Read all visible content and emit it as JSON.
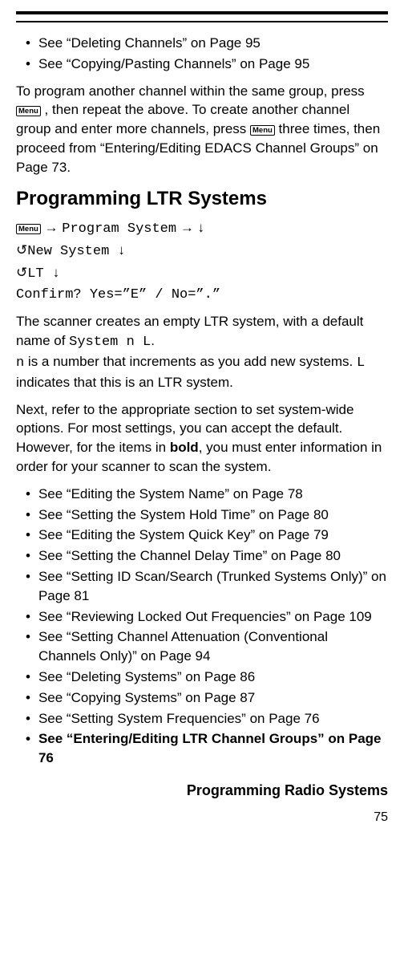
{
  "menu_label": "Menu",
  "top_bullets": [
    "See “Deleting Channels” on Page 95",
    "See “Copying/Pasting Channels” on Page 95"
  ],
  "para1_a": "To program another channel within the same group, press ",
  "para1_b": " , then repeat the above. To create another channel group and enter more channels, press ",
  "para1_c": " three times, then proceed from “Entering/Editing EDACS Channel Groups” on Page 73.",
  "heading": "Programming LTR Systems",
  "seq": {
    "line1_a": " → ",
    "line1_b": "Program System",
    "line1_c": " →  ↓",
    "line2_a": "↺ ",
    "line2_b": "New System",
    "line2_c": " ↓",
    "line3_a": "↺ ",
    "line3_b": "LT",
    "line3_c": " ↓",
    "line4": "Confirm? Yes=”E” / No=”.”"
  },
  "para2_a": "The scanner creates an empty LTR system, with a default name of ",
  "para2_b": "System n      L",
  "para2_c": ".",
  "para2_d": "n",
  "para2_e": " is a number that increments as you add new systems. ",
  "para2_f": "L",
  "para2_g": " indicates that this is an LTR system.",
  "para3_a": "Next, refer to the appropriate section to set system-wide options. For most settings, you can accept the default. However, for the items in ",
  "para3_b": "bold",
  "para3_c": ", you must enter information in order for your scanner to scan the system.",
  "bottom_bullets": [
    "See “Editing the System Name” on Page 78",
    "See “Setting the System Hold Time” on Page 80",
    "See “Editing the System Quick Key” on Page 79",
    "See “Setting the Channel Delay Time” on Page 80",
    "See “Setting ID Scan/Search (Trunked Systems Only)” on Page 81",
    "See “Reviewing Locked Out Frequencies” on Page 109",
    "See “Setting Channel Attenuation (Conventional Channels Only)” on Page 94",
    "See “Deleting Systems” on Page 86",
    "See “Copying Systems” on Page 87",
    "See “Setting System Frequencies” on Page 76"
  ],
  "bottom_bullet_bold": "See “Entering/Editing LTR Channel Groups” on Page 76",
  "footer": "Programming Radio Systems",
  "page_number": "75"
}
